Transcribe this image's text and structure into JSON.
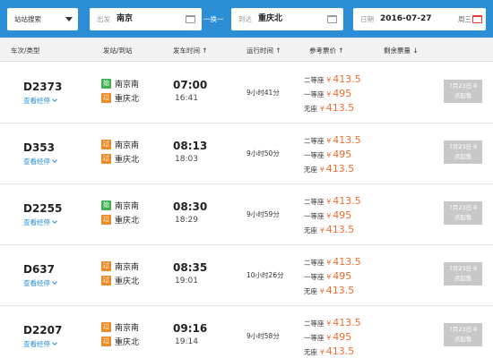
{
  "search": {
    "mode_label": "站站搜索",
    "from_label": "出发",
    "from_value": "南京",
    "swap_label": "一换一",
    "to_label": "到达",
    "to_value": "重庆北",
    "date_label": "日期",
    "date_value": "2016-07-27",
    "weekday": "周三"
  },
  "columns": [
    "车次/类型",
    "发站/到站",
    "发车时间 ↑",
    "运行时间 ↑",
    "参考票价 ↑",
    "剩余票量 ↓"
  ],
  "colors": {
    "primary": "#2c8fd6",
    "price": "#f26a2e",
    "start_badge": "#3fb34f",
    "pass_badge": "#f08a24",
    "disabled_button": "#c8c8c8"
  },
  "rows": [
    {
      "train": "D2373",
      "stops_link": "查看经停",
      "from_badge": "始",
      "from_station": "南京南",
      "to_badge": "过",
      "to_station": "重庆北",
      "depart": "07:00",
      "arrive": "16:41",
      "duration": "9小时41分",
      "seats": [
        {
          "class": "二等座",
          "yen": "¥",
          "price": "413.5"
        },
        {
          "class": "一等座",
          "yen": "¥",
          "price": "495"
        },
        {
          "class": "无座",
          "yen": "¥",
          "price": "413.5"
        }
      ],
      "button_line1": "7月23日 8",
      "button_line2": "点起售"
    },
    {
      "train": "D353",
      "stops_link": "查看经停",
      "from_badge": "过",
      "from_station": "南京南",
      "to_badge": "过",
      "to_station": "重庆北",
      "depart": "08:13",
      "arrive": "18:03",
      "duration": "9小时50分",
      "seats": [
        {
          "class": "二等座",
          "yen": "¥",
          "price": "413.5"
        },
        {
          "class": "一等座",
          "yen": "¥",
          "price": "495"
        },
        {
          "class": "无座",
          "yen": "¥",
          "price": "413.5"
        }
      ],
      "button_line1": "7月23日 8",
      "button_line2": "点起售"
    },
    {
      "train": "D2255",
      "stops_link": "查看经停",
      "from_badge": "始",
      "from_station": "南京南",
      "to_badge": "过",
      "to_station": "重庆北",
      "depart": "08:30",
      "arrive": "18:29",
      "duration": "9小时59分",
      "seats": [
        {
          "class": "二等座",
          "yen": "¥",
          "price": "413.5"
        },
        {
          "class": "一等座",
          "yen": "¥",
          "price": "495"
        },
        {
          "class": "无座",
          "yen": "¥",
          "price": "413.5"
        }
      ],
      "button_line1": "7月23日 8",
      "button_line2": "点起售"
    },
    {
      "train": "D637",
      "stops_link": "查看经停",
      "from_badge": "过",
      "from_station": "南京南",
      "to_badge": "过",
      "to_station": "重庆北",
      "depart": "08:35",
      "arrive": "19:01",
      "duration": "10小时26分",
      "seats": [
        {
          "class": "二等座",
          "yen": "¥",
          "price": "413.5"
        },
        {
          "class": "一等座",
          "yen": "¥",
          "price": "495"
        },
        {
          "class": "无座",
          "yen": "¥",
          "price": "413.5"
        }
      ],
      "button_line1": "7月23日 8",
      "button_line2": "点起售"
    },
    {
      "train": "D2207",
      "stops_link": "查看经停",
      "from_badge": "过",
      "from_station": "南京南",
      "to_badge": "过",
      "to_station": "重庆北",
      "depart": "09:16",
      "arrive": "19:14",
      "duration": "9小时58分",
      "seats": [
        {
          "class": "二等座",
          "yen": "¥",
          "price": "413.5"
        },
        {
          "class": "一等座",
          "yen": "¥",
          "price": "495"
        },
        {
          "class": "无座",
          "yen": "¥",
          "price": "413.5"
        }
      ],
      "button_line1": "7月23日 8",
      "button_line2": "点起售"
    }
  ]
}
